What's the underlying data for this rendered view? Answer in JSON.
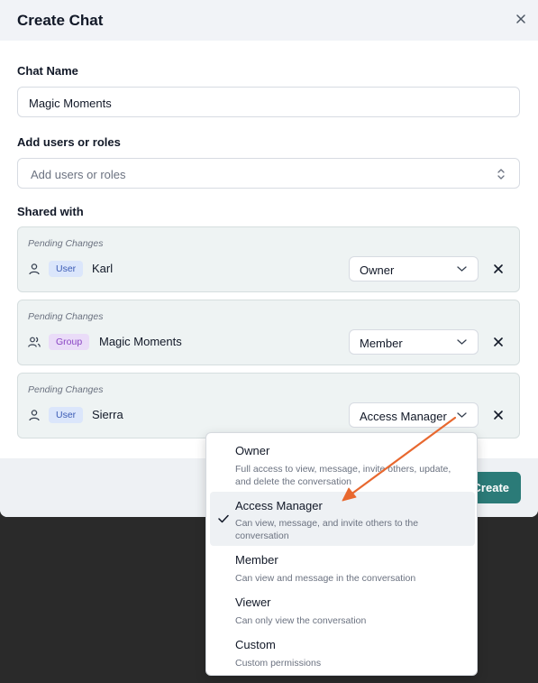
{
  "dialog": {
    "title": "Create Chat",
    "chat_name_label": "Chat Name",
    "chat_name_value": "Magic Moments",
    "add_users_label": "Add users or roles",
    "add_users_placeholder": "Add users or roles",
    "shared_with_label": "Shared with",
    "create_label": "Create"
  },
  "shares": [
    {
      "pending": "Pending Changes",
      "type": "User",
      "name": "Karl",
      "role": "Owner"
    },
    {
      "pending": "Pending Changes",
      "type": "Group",
      "name": "Magic Moments",
      "role": "Member"
    },
    {
      "pending": "Pending Changes",
      "type": "User",
      "name": "Sierra",
      "role": "Access Manager"
    }
  ],
  "role_menu": {
    "options": [
      {
        "title": "Owner",
        "desc": "Full access to view, message, invite others, update, and delete the conversation",
        "selected": false
      },
      {
        "title": "Access Manager",
        "desc": "Can view, message, and invite others to the conversation",
        "selected": true
      },
      {
        "title": "Member",
        "desc": "Can view and message in the conversation",
        "selected": false
      },
      {
        "title": "Viewer",
        "desc": "Can only view the conversation",
        "selected": false
      },
      {
        "title": "Custom",
        "desc": "Custom permissions",
        "selected": false
      }
    ]
  },
  "colors": {
    "accent": "#2b7b78",
    "annotation_arrow": "#e8682f",
    "user_badge_bg": "#dbe6fb",
    "group_badge_bg": "#eadcf8"
  }
}
